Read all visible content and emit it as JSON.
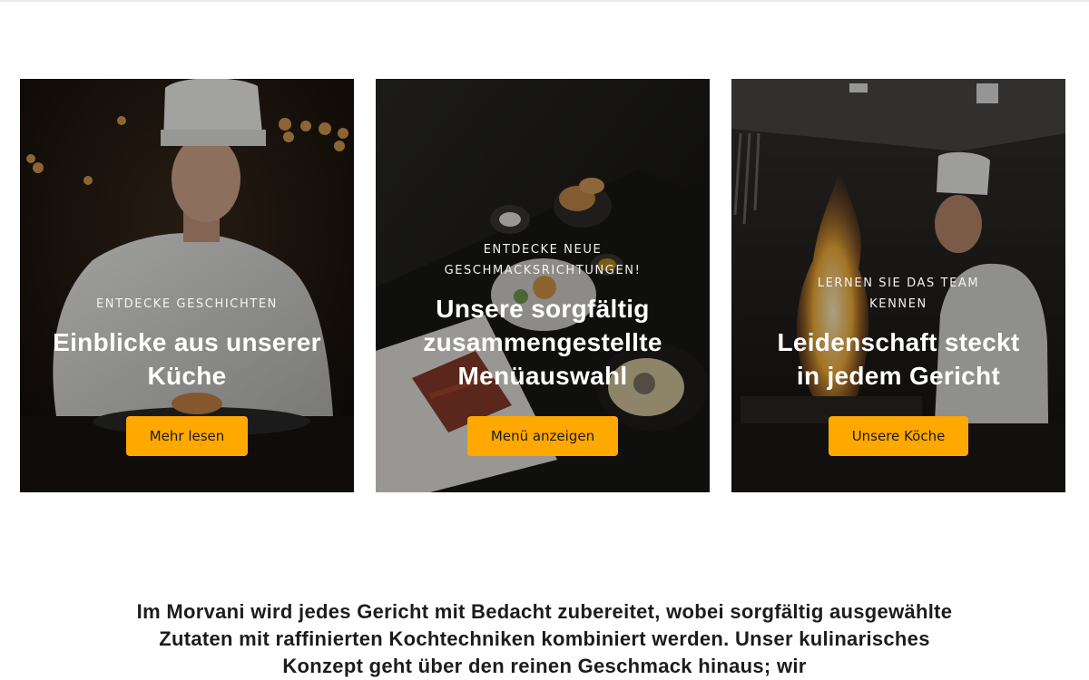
{
  "cards": [
    {
      "eyebrow": "ENTDECKE GESCHICHTEN",
      "title": "Einblicke aus unserer Küche",
      "button": "Mehr lesen",
      "image": "chef-plating-dish-photo"
    },
    {
      "eyebrow": "ENTDECKE NEUE GESCHMACKSRICHTUNGEN!",
      "title": "Unsere sorgfältig zusammengestellte Menüauswahl",
      "button": "Menü anzeigen",
      "image": "plated-dishes-table-photo"
    },
    {
      "eyebrow": "LERNEN SIE DAS TEAM KENNEN",
      "title": "Leidenschaft steckt in jedem Gericht",
      "button": "Unsere Köche",
      "image": "chef-flambe-kitchen-photo"
    }
  ],
  "intro": {
    "text": "Im Morvani wird jedes Gericht mit Bedacht zubereitet, wobei sorgfältig ausgewählte Zutaten mit raffinierten Kochtechniken kombiniert werden. Unser kulinarisches Konzept geht über den reinen Geschmack hinaus; wir"
  },
  "colors": {
    "accent": "#ffa800",
    "text": "#1c1c1c"
  }
}
